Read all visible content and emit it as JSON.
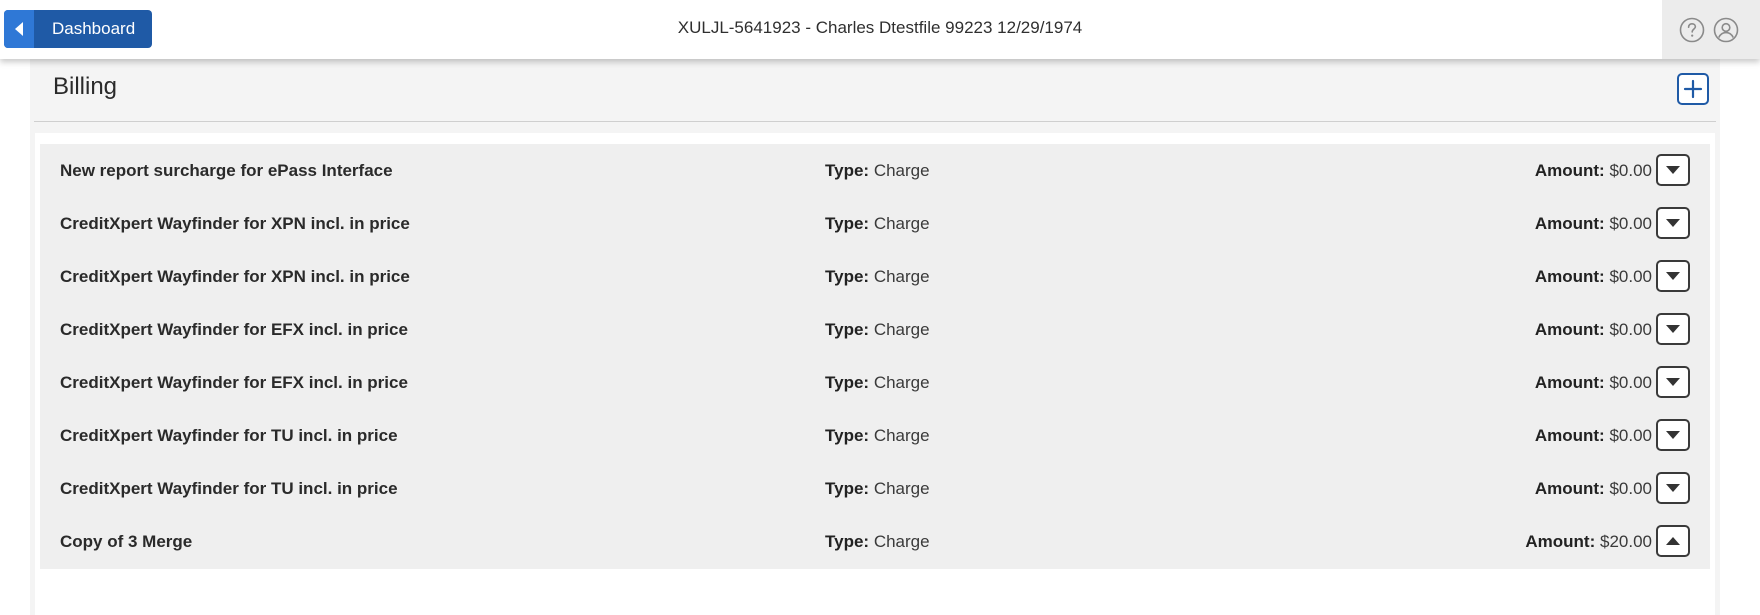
{
  "header": {
    "back_label": "Dashboard",
    "title": "XULJL-5641923 - Charles Dtestfile 99223 12/29/1974",
    "icons": [
      "help-icon",
      "user-account-icon"
    ]
  },
  "billing": {
    "title": "Billing",
    "add_icon": "plus-icon",
    "type_label": "Type:",
    "amount_label": "Amount:",
    "items": [
      {
        "description": "New report surcharge for ePass Interface",
        "type": "Charge",
        "amount": "$0.00",
        "toggle": "expand"
      },
      {
        "description": "CreditXpert Wayfinder for XPN incl. in price",
        "type": "Charge",
        "amount": "$0.00",
        "toggle": "expand"
      },
      {
        "description": "CreditXpert Wayfinder for XPN incl. in price",
        "type": "Charge",
        "amount": "$0.00",
        "toggle": "expand"
      },
      {
        "description": "CreditXpert Wayfinder for EFX incl. in price",
        "type": "Charge",
        "amount": "$0.00",
        "toggle": "expand"
      },
      {
        "description": "CreditXpert Wayfinder for EFX incl. in price",
        "type": "Charge",
        "amount": "$0.00",
        "toggle": "expand"
      },
      {
        "description": "CreditXpert Wayfinder for TU incl. in price",
        "type": "Charge",
        "amount": "$0.00",
        "toggle": "expand"
      },
      {
        "description": "CreditXpert Wayfinder for TU incl. in price",
        "type": "Charge",
        "amount": "$0.00",
        "toggle": "expand"
      },
      {
        "description": "Copy of 3 Merge",
        "type": "Charge",
        "amount": "$20.00",
        "toggle": "collapse"
      }
    ]
  },
  "colors": {
    "primary": "#1f5aa6",
    "primary_light": "#2f78d6",
    "row_background": "#efefef",
    "panel_background": "#f4f4f4"
  }
}
